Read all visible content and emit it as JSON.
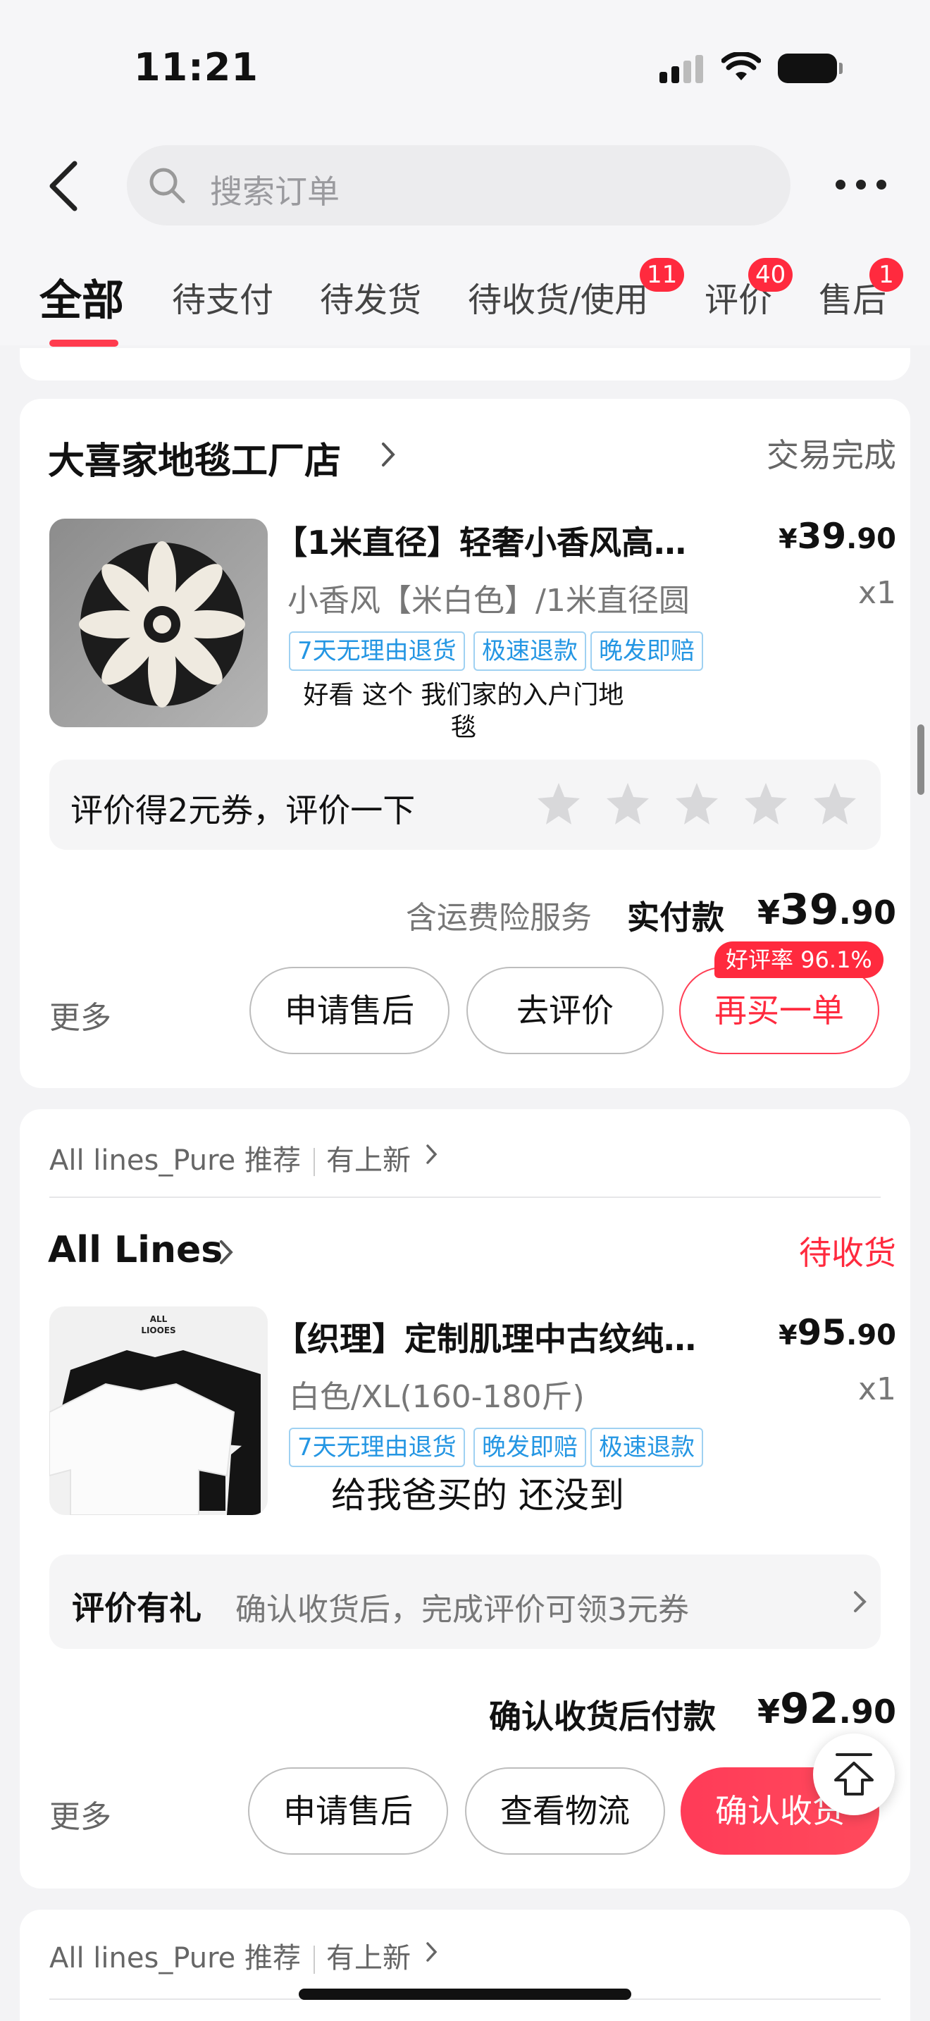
{
  "status_bar": {
    "time": "11:21"
  },
  "search": {
    "placeholder": "搜索订单"
  },
  "tabs": [
    {
      "label": "全部",
      "badge": ""
    },
    {
      "label": "待支付",
      "badge": ""
    },
    {
      "label": "待发货",
      "badge": ""
    },
    {
      "label": "待收货/使用",
      "badge": "11"
    },
    {
      "label": "评价",
      "badge": "40"
    },
    {
      "label": "售后",
      "badge": "1"
    }
  ],
  "orders": [
    {
      "shop": "大喜家地毯工厂店",
      "status": "交易完成",
      "status_color": "#666666",
      "product_title": "【1米直径】轻奢小香风高…",
      "price": {
        "symbol": "¥",
        "integer": "39",
        "decimal": ".90"
      },
      "spec": "小香风【米白色】/1米直径圆",
      "qty": "x1",
      "tags": [
        "7天无理由退货",
        "极速退款",
        "晚发即赔"
      ],
      "note_line1": "好看 这个 我们家的入户门地",
      "note_line2": "毯",
      "review_prompt": "评价得2元券，评价一下",
      "stars": 5,
      "service_text": "含运费险服务",
      "paid_label": "实付款",
      "paid": {
        "symbol": "¥",
        "integer": "39",
        "decimal": ".90"
      },
      "more": "更多",
      "buttons": [
        "申请售后",
        "去评价",
        "再买一单"
      ],
      "good_rate": "好评率 96.1%"
    },
    {
      "recommend_store": "All lines_Pure 推荐",
      "recommend_new": "有上新",
      "shop": "All Lines",
      "status": "待收货",
      "status_color": "#ff2a3e",
      "product_title": "【织理】定制肌理中古纹纯…",
      "price": {
        "symbol": "¥",
        "integer": "95",
        "decimal": ".90"
      },
      "spec": "白色/XL(160-180斤)",
      "qty": "x1",
      "tags": [
        "7天无理由退货",
        "晚发即赔",
        "极速退款"
      ],
      "note": "给我爸买的 还没到",
      "thumb_brand": "ALL LIOOES",
      "review_title": "评价有礼",
      "review_desc": "确认收货后，完成评价可领3元券",
      "paid_label": "确认收货后付款",
      "paid": {
        "symbol": "¥",
        "integer": "92",
        "decimal": ".90"
      },
      "more": "更多",
      "buttons": [
        "申请售后",
        "查看物流",
        "确认收货"
      ]
    }
  ],
  "next_recommend": {
    "store": "All lines_Pure 推荐",
    "new": "有上新"
  }
}
